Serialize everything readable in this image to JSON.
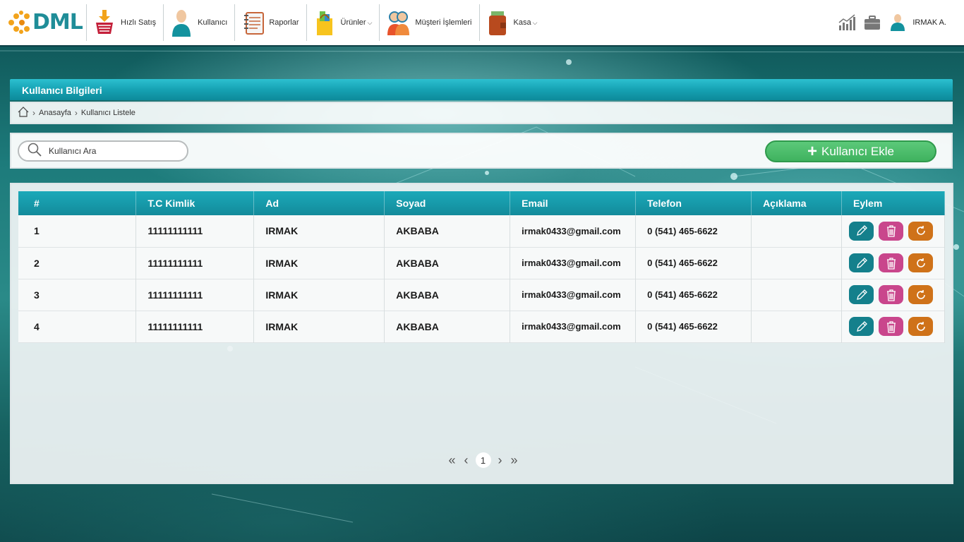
{
  "nav": {
    "logo_text": "DML",
    "items": [
      {
        "label": "Hızlı Satış",
        "icon": "basket-icon"
      },
      {
        "label": "Kullanıcı",
        "icon": "user-icon"
      },
      {
        "label": "Raporlar",
        "icon": "notebook-icon"
      },
      {
        "label": "Ürünler",
        "icon": "shopping-bag-icon",
        "dropdown": true
      },
      {
        "label": "Müşteri İşlemleri",
        "icon": "customers-icon"
      },
      {
        "label": "Kasa",
        "icon": "wallet-icon",
        "dropdown": true
      }
    ],
    "user_name": "IRMAK A."
  },
  "page": {
    "title": "Kullanıcı Bilgileri",
    "breadcrumb": [
      "Anasayfa",
      "Kullanıcı Listele"
    ]
  },
  "toolbar": {
    "search_placeholder": "Kullanıcı Ara",
    "add_label": "Kullanıcı Ekle"
  },
  "table": {
    "headers": [
      "#",
      "T.C Kimlik",
      "Ad",
      "Soyad",
      "Email",
      "Telefon",
      "Açıklama",
      "Eylem"
    ],
    "rows": [
      {
        "no": "1",
        "tc": "11111111111",
        "ad": "IRMAK",
        "soyad": "AKBABA",
        "email": "irmak0433@gmail.com",
        "telefon": "0 (541) 465-6622",
        "aciklama": ""
      },
      {
        "no": "2",
        "tc": "11111111111",
        "ad": "IRMAK",
        "soyad": "AKBABA",
        "email": "irmak0433@gmail.com",
        "telefon": "0 (541) 465-6622",
        "aciklama": ""
      },
      {
        "no": "3",
        "tc": "11111111111",
        "ad": "IRMAK",
        "soyad": "AKBABA",
        "email": "irmak0433@gmail.com",
        "telefon": "0 (541) 465-6622",
        "aciklama": ""
      },
      {
        "no": "4",
        "tc": "11111111111",
        "ad": "IRMAK",
        "soyad": "AKBABA",
        "email": "irmak0433@gmail.com",
        "telefon": "0 (541) 465-6622",
        "aciklama": ""
      }
    ]
  },
  "pagination": {
    "current": "1"
  },
  "colors": {
    "accent": "#16a2b3",
    "edit": "#14808c",
    "delete": "#c9468c",
    "reset": "#cf7219",
    "add": "#4bbd6a"
  }
}
